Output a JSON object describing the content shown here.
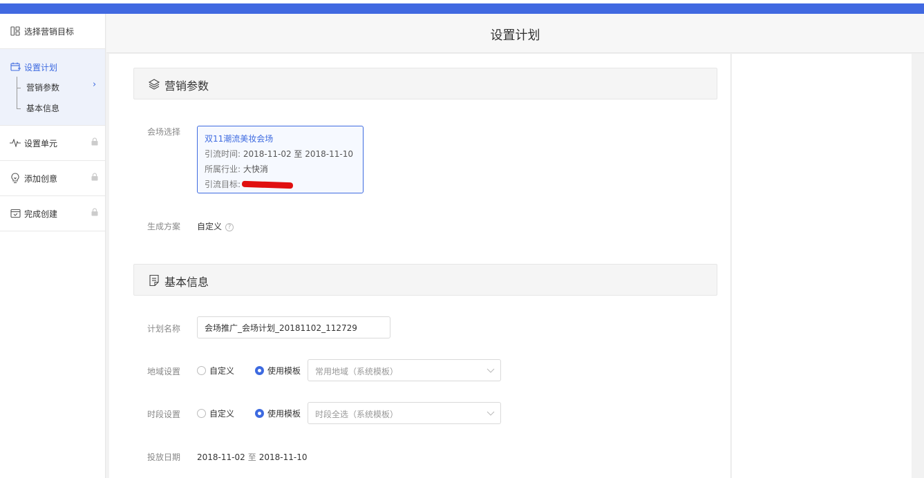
{
  "header": {
    "title": "设置计划"
  },
  "sidebar": {
    "steps": [
      {
        "label": "选择营销目标"
      },
      {
        "label": "设置计划",
        "subitems": [
          "营销参数",
          "基本信息"
        ]
      },
      {
        "label": "设置单元"
      },
      {
        "label": "添加创意"
      },
      {
        "label": "完成创建"
      }
    ]
  },
  "marketing": {
    "title": "营销参数",
    "venue_label": "会场选择",
    "venue": {
      "name": "双11潮流美妆会场",
      "time_label": "引流时间:",
      "time_value": "2018-11-02 至 2018-11-10",
      "industry_label": "所属行业:",
      "industry_value": "大快消",
      "target_label": "引流目标:"
    },
    "plan_label": "生成方案",
    "plan_value": "自定义"
  },
  "basic": {
    "title": "基本信息",
    "name_label": "计划名称",
    "name_value": "会场推广_会场计划_20181102_112729",
    "region_label": "地域设置",
    "region_option_custom": "自定义",
    "region_option_template": "使用模板",
    "region_select": "常用地域（系统模板）",
    "time_label": "时段设置",
    "time_option_custom": "自定义",
    "time_option_template": "使用模板",
    "time_select": "时段全选（系统模板）",
    "date_label": "投放日期",
    "date_start": "2018-11-02",
    "date_sep": "至",
    "date_end": "2018-11-10"
  },
  "colors": {
    "accent": "#3d6ae0",
    "topbar": "#4169e1",
    "redaction": "#e01010"
  }
}
